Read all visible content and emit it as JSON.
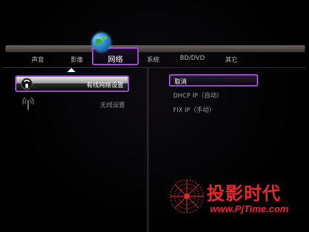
{
  "tabs": {
    "audio": "声音",
    "video": "影像",
    "network": "网络",
    "system": "系统",
    "bd_dvd": "BD/DVD",
    "other": "其它"
  },
  "network_menu": {
    "wired": "有线网络设置",
    "wireless": "无线设置"
  },
  "options": {
    "cancel": "取消",
    "dhcp": "DHCP IP（自动）",
    "fixed": "FIX IP（手动）"
  },
  "watermark": {
    "name": "投影时代",
    "url": "www.PjTime.com"
  },
  "colors": {
    "selection_border": "#a24fd6",
    "watermark": "#e5282d"
  }
}
